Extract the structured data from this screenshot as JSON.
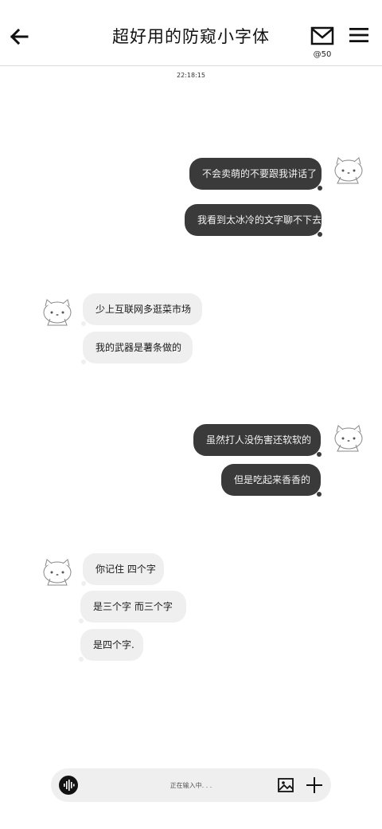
{
  "header": {
    "title": "超好用的防窥小字体",
    "mail_count": "@50"
  },
  "chat": {
    "timestamp": "22:18:15",
    "messages": [
      {
        "side": "out",
        "text": "不会卖萌的不要跟我讲话了"
      },
      {
        "side": "out",
        "text": "我看到太冰冷的文字聊不下去."
      },
      {
        "side": "in",
        "text": "少上互联网多逛菜市场"
      },
      {
        "side": "in",
        "text": "我的武器是薯条做的"
      },
      {
        "side": "out",
        "text": "虽然打人没伤害还软软的"
      },
      {
        "side": "out",
        "text": "但是吃起来香香的"
      },
      {
        "side": "in",
        "text": "你记住  四个字"
      },
      {
        "side": "in",
        "text": "是三个字  而三个字"
      },
      {
        "side": "in",
        "text": "是四个字."
      }
    ]
  },
  "composer": {
    "placeholder": "正在输入中. . ."
  },
  "icons": {
    "back": "arrow-left-icon",
    "mail": "mail-icon",
    "menu": "hamburger-menu-icon",
    "voice": "voice-wave-icon",
    "image": "image-icon",
    "plus": "plus-icon",
    "avatar": "kitty-avatar"
  }
}
